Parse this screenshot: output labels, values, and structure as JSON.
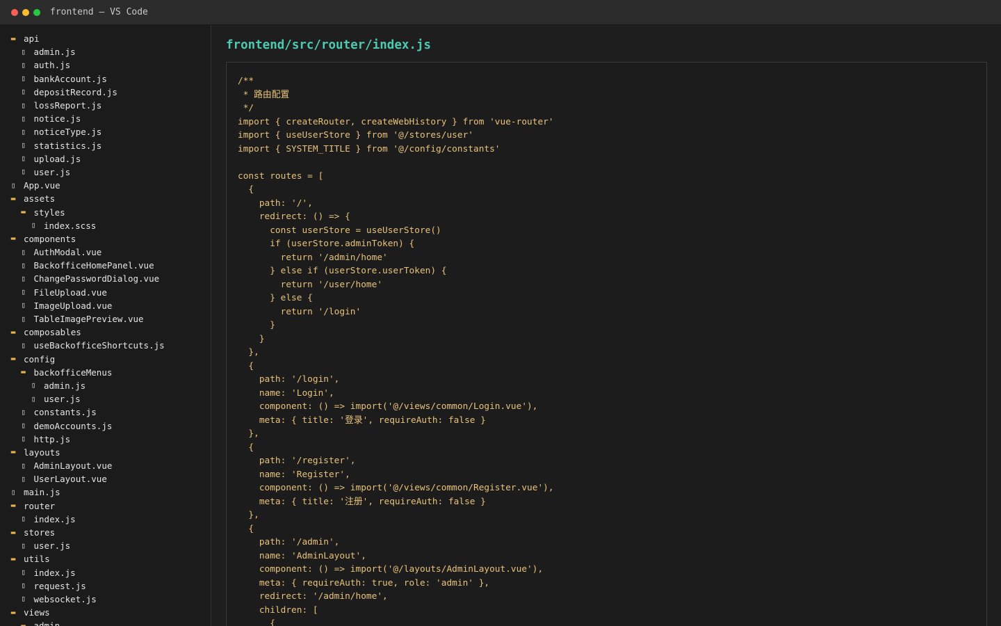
{
  "window": {
    "title": "frontend — VS Code"
  },
  "colors": {
    "accent_path": "#4ec9b0",
    "code_text": "#e8c27a",
    "folder_icon": "#e8b44c"
  },
  "explorer": {
    "items": [
      {
        "name": "api",
        "type": "folder",
        "depth": 0
      },
      {
        "name": "admin.js",
        "type": "file",
        "depth": 1
      },
      {
        "name": "auth.js",
        "type": "file",
        "depth": 1
      },
      {
        "name": "bankAccount.js",
        "type": "file",
        "depth": 1
      },
      {
        "name": "depositRecord.js",
        "type": "file",
        "depth": 1
      },
      {
        "name": "lossReport.js",
        "type": "file",
        "depth": 1
      },
      {
        "name": "notice.js",
        "type": "file",
        "depth": 1
      },
      {
        "name": "noticeType.js",
        "type": "file",
        "depth": 1
      },
      {
        "name": "statistics.js",
        "type": "file",
        "depth": 1
      },
      {
        "name": "upload.js",
        "type": "file",
        "depth": 1
      },
      {
        "name": "user.js",
        "type": "file",
        "depth": 1
      },
      {
        "name": "App.vue",
        "type": "file",
        "depth": 0
      },
      {
        "name": "assets",
        "type": "folder",
        "depth": 0
      },
      {
        "name": "styles",
        "type": "folder",
        "depth": 1
      },
      {
        "name": "index.scss",
        "type": "file",
        "depth": 2
      },
      {
        "name": "components",
        "type": "folder",
        "depth": 0
      },
      {
        "name": "AuthModal.vue",
        "type": "file",
        "depth": 1
      },
      {
        "name": "BackofficeHomePanel.vue",
        "type": "file",
        "depth": 1
      },
      {
        "name": "ChangePasswordDialog.vue",
        "type": "file",
        "depth": 1
      },
      {
        "name": "FileUpload.vue",
        "type": "file",
        "depth": 1
      },
      {
        "name": "ImageUpload.vue",
        "type": "file",
        "depth": 1
      },
      {
        "name": "TableImagePreview.vue",
        "type": "file",
        "depth": 1
      },
      {
        "name": "composables",
        "type": "folder",
        "depth": 0
      },
      {
        "name": "useBackofficeShortcuts.js",
        "type": "file",
        "depth": 1
      },
      {
        "name": "config",
        "type": "folder",
        "depth": 0
      },
      {
        "name": "backofficeMenus",
        "type": "folder",
        "depth": 1
      },
      {
        "name": "admin.js",
        "type": "file",
        "depth": 2
      },
      {
        "name": "user.js",
        "type": "file",
        "depth": 2
      },
      {
        "name": "constants.js",
        "type": "file",
        "depth": 1
      },
      {
        "name": "demoAccounts.js",
        "type": "file",
        "depth": 1
      },
      {
        "name": "http.js",
        "type": "file",
        "depth": 1
      },
      {
        "name": "layouts",
        "type": "folder",
        "depth": 0
      },
      {
        "name": "AdminLayout.vue",
        "type": "file",
        "depth": 1
      },
      {
        "name": "UserLayout.vue",
        "type": "file",
        "depth": 1
      },
      {
        "name": "main.js",
        "type": "file",
        "depth": 0
      },
      {
        "name": "router",
        "type": "folder",
        "depth": 0
      },
      {
        "name": "index.js",
        "type": "file",
        "depth": 1
      },
      {
        "name": "stores",
        "type": "folder",
        "depth": 0
      },
      {
        "name": "user.js",
        "type": "file",
        "depth": 1
      },
      {
        "name": "utils",
        "type": "folder",
        "depth": 0
      },
      {
        "name": "index.js",
        "type": "file",
        "depth": 1
      },
      {
        "name": "request.js",
        "type": "file",
        "depth": 1
      },
      {
        "name": "websocket.js",
        "type": "file",
        "depth": 1
      },
      {
        "name": "views",
        "type": "folder",
        "depth": 0
      },
      {
        "name": "admin",
        "type": "folder",
        "depth": 1
      }
    ]
  },
  "editor": {
    "file_path": "frontend/src/router/index.js",
    "lines": [
      "/**",
      " * 路由配置",
      " */",
      "import { createRouter, createWebHistory } from 'vue-router'",
      "import { useUserStore } from '@/stores/user'",
      "import { SYSTEM_TITLE } from '@/config/constants'",
      "",
      "const routes = [",
      "  {",
      "    path: '/',",
      "    redirect: () => {",
      "      const userStore = useUserStore()",
      "      if (userStore.adminToken) {",
      "        return '/admin/home'",
      "      } else if (userStore.userToken) {",
      "        return '/user/home'",
      "      } else {",
      "        return '/login'",
      "      }",
      "    }",
      "  },",
      "  {",
      "    path: '/login',",
      "    name: 'Login',",
      "    component: () => import('@/views/common/Login.vue'),",
      "    meta: { title: '登录', requireAuth: false }",
      "  },",
      "  {",
      "    path: '/register',",
      "    name: 'Register',",
      "    component: () => import('@/views/common/Register.vue'),",
      "    meta: { title: '注册', requireAuth: false }",
      "  },",
      "  {",
      "    path: '/admin',",
      "    name: 'AdminLayout',",
      "    component: () => import('@/layouts/AdminLayout.vue'),",
      "    meta: { requireAuth: true, role: 'admin' },",
      "    redirect: '/admin/home',",
      "    children: [",
      "      {"
    ]
  }
}
